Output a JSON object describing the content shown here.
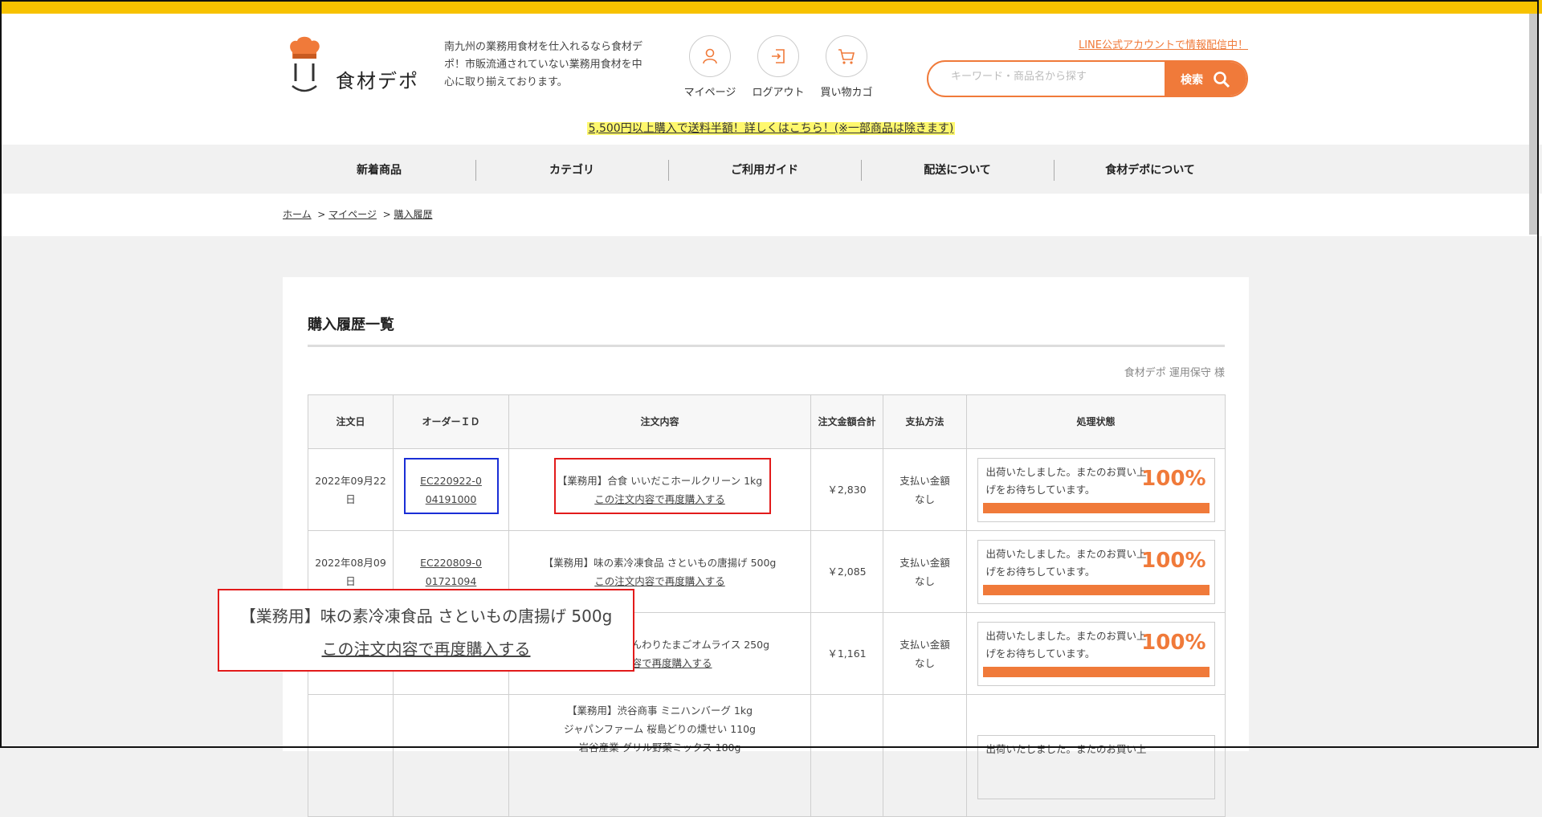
{
  "header": {
    "logo_text": "食材デポ",
    "description": "南九州の業務用食材を仕入れるなら食材デポ！市販流通されていない業務用食材を中心に取り揃えております。",
    "icons": [
      {
        "label": "マイページ",
        "icon": "user-icon"
      },
      {
        "label": "ログアウト",
        "icon": "logout-icon"
      },
      {
        "label": "買い物カゴ",
        "icon": "cart-icon"
      }
    ],
    "line_link": "LINE公式アカウントで情報配信中！",
    "search_placeholder": "キーワード・商品名から探す",
    "search_button": "検索",
    "promo": "5,500円以上購入で送料半額！詳しくはこちら！(※一部商品は除きます)"
  },
  "nav": [
    "新着商品",
    "カテゴリ",
    "ご利用ガイド",
    "配送について",
    "食材デポについて"
  ],
  "breadcrumb": {
    "home": "ホーム",
    "mypage": "マイページ",
    "current": "購入履歴",
    "sep": ">"
  },
  "page": {
    "title": "購入履歴一覧",
    "user": "食材デポ 運用保守 様"
  },
  "table": {
    "headers": [
      "注文日",
      "オーダーＩＤ",
      "注文内容",
      "注文金額合計",
      "支払方法",
      "処理状態"
    ],
    "rows": [
      {
        "date": "2022年09月22日",
        "order_id": "EC220922-004191000",
        "item": "【業務用】合食 いいだこホールクリーン 1kg",
        "reorder": "この注文内容で再度購入する",
        "total": "￥2,830",
        "payment": "支払い金額なし",
        "status": "出荷いたしました。またのお買い上げをお待ちしています。",
        "progress": "100%"
      },
      {
        "date": "2022年08月09日",
        "order_id": "EC220809-001721094",
        "item": "【業務用】味の素冷凍食品 さといもの唐揚げ 500g",
        "reorder": "この注文内容で再度購入する",
        "total": "￥2,085",
        "payment": "支払い金額なし",
        "status": "出荷いたしました。またのお買い上げをお待ちしています。",
        "progress": "100%"
      },
      {
        "date": "",
        "order_id": "",
        "item": "ふんわりたまごオムライス 250g",
        "reorder": "内容で再度購入する",
        "total": "￥1,161",
        "payment": "支払い金額なし",
        "status": "出荷いたしました。またのお買い上げをお待ちしています。",
        "progress": "100%"
      },
      {
        "items": [
          "【業務用】渋谷商事 ミニハンバーグ 1kg",
          "ジャパンファーム 桜島どりの燻せい 110g",
          "岩谷産業 グリル野菜ミックス 180g"
        ],
        "status": "出荷いたしました。またのお買い上"
      }
    ]
  },
  "zoom": {
    "item": "【業務用】味の素冷凍食品 さといもの唐揚げ 500g",
    "reorder": "この注文内容で再度購入する"
  },
  "colors": {
    "accent": "#f07a3a",
    "topbar": "#f7c200",
    "highlight_blue": "#1a2ed6",
    "highlight_red": "#e21b1b"
  }
}
